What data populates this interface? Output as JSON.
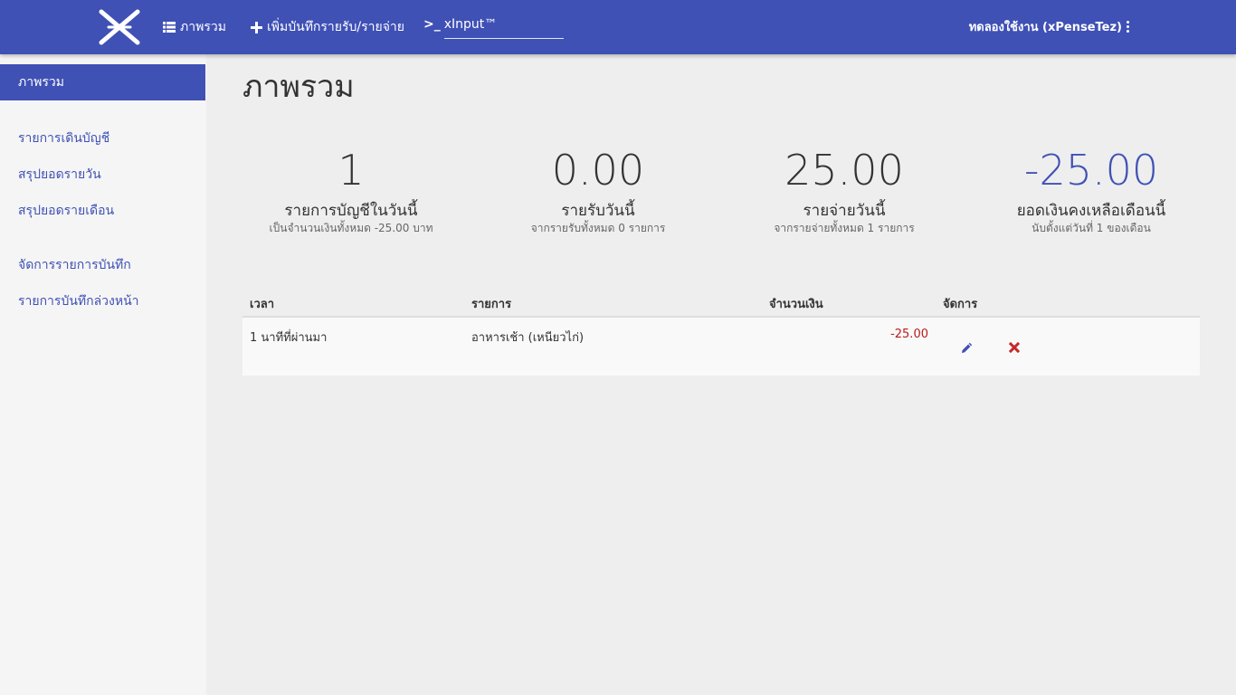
{
  "navbar": {
    "overview_label": "ภาพรวม",
    "add_entry_label": "เพิ่มบันทึกรายรับ/รายจ่าย",
    "xinput_prompt": ">_",
    "xinput_value": "xInput™",
    "user_label": "ทดลองใช้งาน (xPenseTez)",
    "brand_color": "#3f51b5"
  },
  "sidebar": {
    "active_item": "ภาพรวม",
    "items": [
      "รายการเดินบัญชี",
      "สรุปยอดรายวัน",
      "สรุปยอดรายเดือน",
      "จัดการรายการบันทึก",
      "รายการบันทึกล่วงหน้า"
    ]
  },
  "main": {
    "title": "ภาพรวม",
    "stats": [
      {
        "value": "1",
        "label": "รายการบัญชีในวันนี้",
        "sub": "เป็นจำนวนเงินทั้งหมด -25.00 บาท",
        "color": "#333333"
      },
      {
        "value": "0.00",
        "label": "รายรับวันนี้",
        "sub": "จากรายรับทั้งหมด 0 รายการ",
        "color": "#333333"
      },
      {
        "value": "25.00",
        "label": "รายจ่ายวันนี้",
        "sub": "จากรายจ่ายทั้งหมด 1 รายการ",
        "color": "#333333"
      },
      {
        "value": "-25.00",
        "label": "ยอดเงินคงเหลือเดือนนี้",
        "sub": "นับตั้งแต่วันที่ 1 ของเดือน",
        "color": "#3f51b5"
      }
    ],
    "table": {
      "headers": [
        "เวลา",
        "รายการ",
        "จำนวนเงิน",
        "จัดการ"
      ],
      "rows": [
        {
          "time": "1 นาทีที่ผ่านมา",
          "item": "อาหารเช้า (เหนียวไก่)",
          "amount": "-25.00",
          "amount_color": "#b71c1c"
        }
      ]
    }
  },
  "icons": {
    "overview": "list-icon",
    "add": "plus-icon",
    "terminal": "terminal-icon",
    "menu": "more-vertical-icon",
    "edit": "pencil-icon",
    "delete": "close-icon"
  }
}
